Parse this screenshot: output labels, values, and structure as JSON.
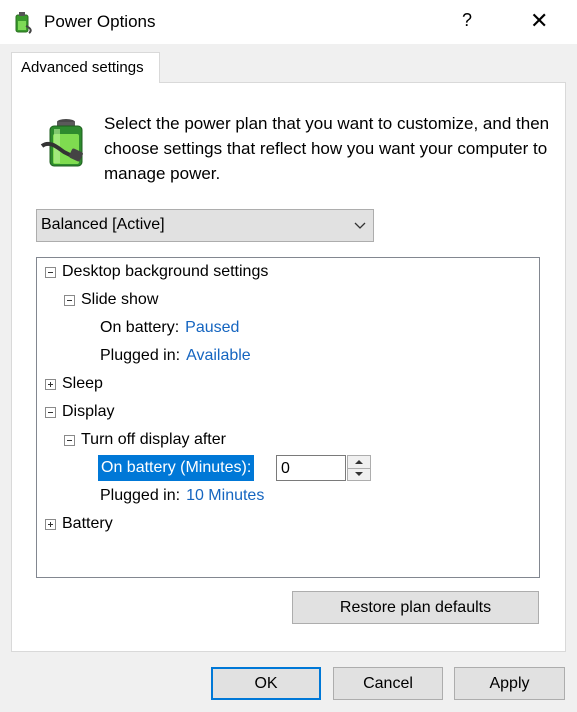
{
  "window": {
    "title": "Power Options",
    "help_glyph": "?",
    "close_glyph": "✕"
  },
  "tab": {
    "label": "Advanced settings"
  },
  "intro": {
    "text": "Select the power plan that you want to customize, and then choose settings that reflect how you want your computer to manage power."
  },
  "plan_select": {
    "value": "Balanced [Active]"
  },
  "tree": {
    "desktop_bg": "Desktop background settings",
    "slide_show": "Slide show",
    "slide_on_battery_label": "On battery:",
    "slide_on_battery_value": "Paused",
    "slide_plugged_label": "Plugged in:",
    "slide_plugged_value": "Available",
    "sleep": "Sleep",
    "display": "Display",
    "turn_off_display": "Turn off display after",
    "display_on_battery_label": "On battery (Minutes):",
    "display_on_battery_value": "0",
    "display_plugged_label": "Plugged in:",
    "display_plugged_value": "10 Minutes",
    "battery": "Battery"
  },
  "buttons": {
    "restore": "Restore plan defaults",
    "ok": "OK",
    "cancel": "Cancel",
    "apply": "Apply"
  },
  "colors": {
    "accent": "#0078d7",
    "value_link": "#1565c0"
  },
  "icons": [
    "power-options-icon",
    "help-icon",
    "close-icon",
    "battery-plug-icon",
    "chevron-down-icon",
    "collapse-icon",
    "expand-icon",
    "spin-up-icon",
    "spin-down-icon"
  ]
}
